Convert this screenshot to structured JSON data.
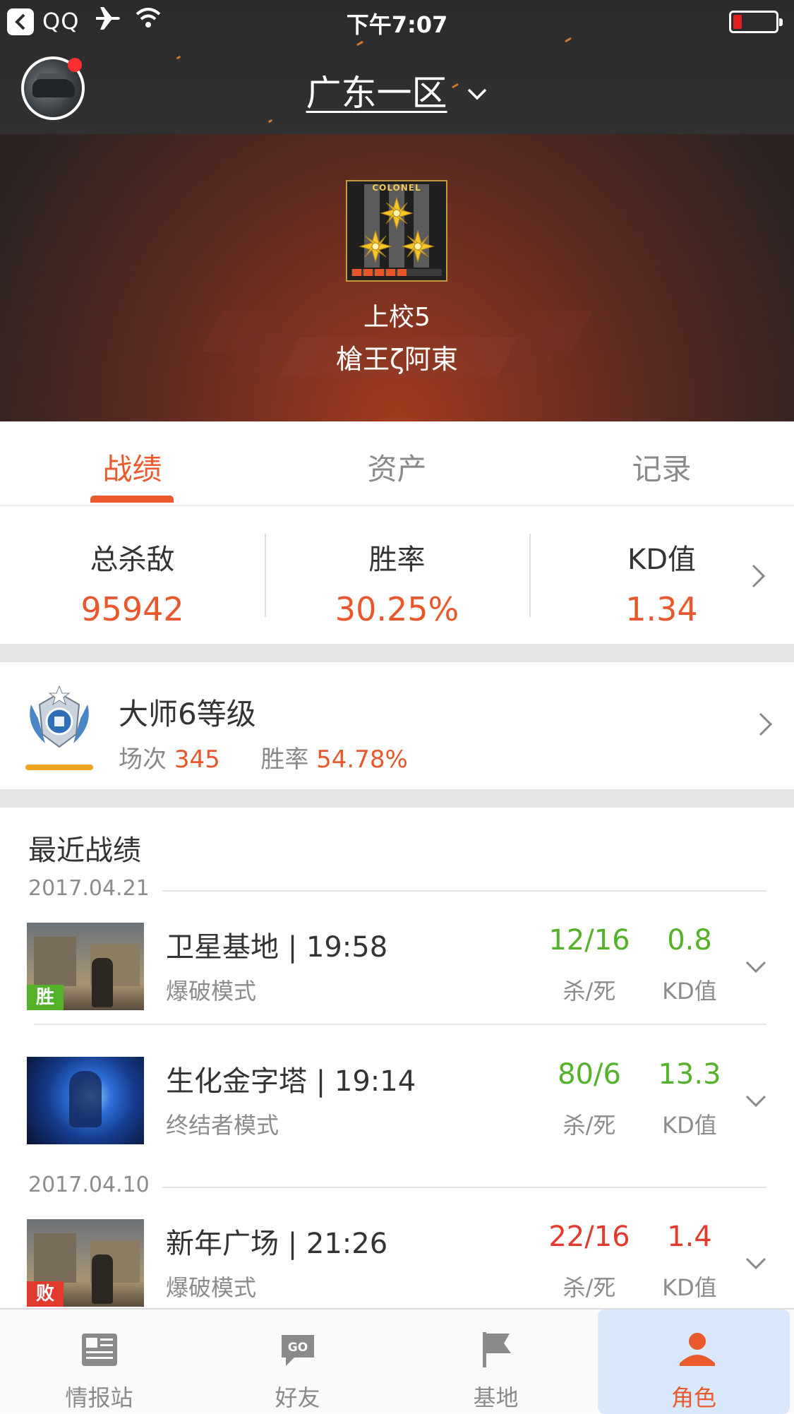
{
  "status_bar": {
    "carrier": "QQ",
    "time": "下午7:07"
  },
  "header": {
    "server": "广东一区",
    "rank_badge_text": "COLONEL",
    "rank_progress_segments_filled": 5,
    "rank_progress_segments_total": 8,
    "rank": "上校5",
    "player_name": "槍王ζ阿東"
  },
  "tabs": [
    {
      "label": "战绩",
      "active": true
    },
    {
      "label": "资产",
      "active": false
    },
    {
      "label": "记录",
      "active": false
    }
  ],
  "stats": [
    {
      "label": "总杀敌",
      "value": "95942"
    },
    {
      "label": "胜率",
      "value": "30.25%"
    },
    {
      "label": "KD值",
      "value": "1.34"
    }
  ],
  "rank_card": {
    "title": "大师6等级",
    "matches_label": "场次",
    "matches_value": "345",
    "winrate_label": "胜率",
    "winrate_value": "54.78%"
  },
  "recent": {
    "title": "最近战绩",
    "dates": [
      "2017.04.21",
      "2017.04.10"
    ],
    "matches": [
      {
        "map_time": "卫星基地 | 19:58",
        "mode": "爆破模式",
        "kd": "12/16",
        "kd_label": "杀/死",
        "ratio": "0.8",
        "ratio_label": "KD值",
        "result": "胜",
        "color": "#53b22a"
      },
      {
        "map_time": "生化金字塔 | 19:14",
        "mode": "终结者模式",
        "kd": "80/6",
        "kd_label": "杀/死",
        "ratio": "13.3",
        "ratio_label": "KD值",
        "result": "",
        "color": "#53b22a"
      },
      {
        "map_time": "新年广场 | 21:26",
        "mode": "爆破模式",
        "kd": "22/16",
        "kd_label": "杀/死",
        "ratio": "1.4",
        "ratio_label": "KD值",
        "result": "败",
        "color": "#e23b2e"
      }
    ]
  },
  "bottom_nav": [
    {
      "label": "情报站",
      "icon": "newspaper-icon"
    },
    {
      "label": "好友",
      "icon": "chat-icon"
    },
    {
      "label": "基地",
      "icon": "flag-icon"
    },
    {
      "label": "角色",
      "icon": "person-icon",
      "active": true
    }
  ],
  "colors": {
    "accent": "#ea5a2c",
    "win": "#53b22a",
    "lose": "#e23b2e"
  }
}
